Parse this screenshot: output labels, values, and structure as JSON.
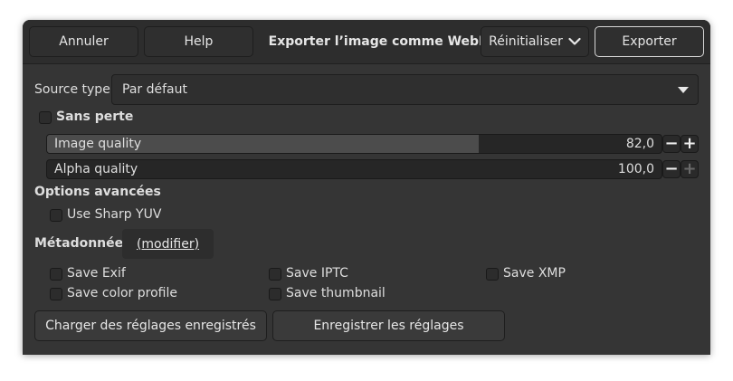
{
  "header": {
    "cancel_label": "Annuler",
    "help_label": "Help",
    "title": "Exporter l’image comme WebP",
    "reset_label": "Réinitialiser",
    "export_label": "Exporter"
  },
  "source_type": {
    "label": "Source type",
    "selected": "Par défaut"
  },
  "lossless": {
    "label": "Sans perte",
    "checked": false
  },
  "image_quality": {
    "label": "Image quality",
    "value": "82,0",
    "fraction": 0.82
  },
  "alpha_quality": {
    "label": "Alpha quality",
    "value": "100,0",
    "fraction": 1.0
  },
  "advanced": {
    "heading": "Options avancées",
    "sharp_yuv_label": "Use Sharp YUV"
  },
  "metadata": {
    "heading": "Métadonnées",
    "modify_label": "(modifier)",
    "options": {
      "save_exif": "Save Exif",
      "save_iptc": "Save IPTC",
      "save_xmp": "Save XMP",
      "save_color_profile": "Save color profile",
      "save_thumbnail": "Save thumbnail"
    }
  },
  "footer": {
    "load_label": "Charger des réglages enregistrés",
    "save_label": "Enregistrer les réglages"
  },
  "colors": {
    "window_bg": "#353535",
    "header_bg": "#2d2d2d",
    "slider_fill": "#4c4c4c"
  }
}
